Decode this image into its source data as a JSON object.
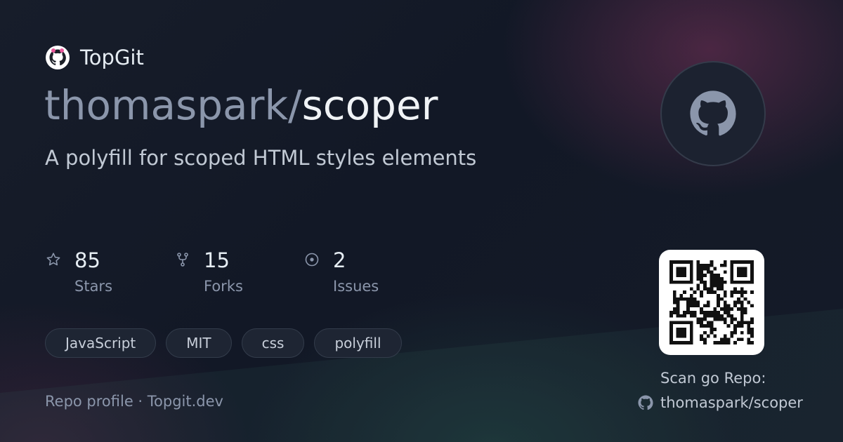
{
  "brand": {
    "name": "TopGit"
  },
  "repo": {
    "owner": "thomaspark/",
    "name": "scoper",
    "description": "A polyfill for scoped HTML styles elements"
  },
  "stats": [
    {
      "icon": "star-icon",
      "value": "85",
      "label": "Stars"
    },
    {
      "icon": "fork-icon",
      "value": "15",
      "label": "Forks"
    },
    {
      "icon": "issue-icon",
      "value": "2",
      "label": "Issues"
    }
  ],
  "tags": [
    "JavaScript",
    "MIT",
    "css",
    "polyfill"
  ],
  "footer": {
    "text": "Repo profile · Topgit.dev"
  },
  "qr": {
    "caption": "Scan go Repo:",
    "link": "thomaspark/scoper"
  },
  "colors": {
    "accent_pink": "#e8579a",
    "muted": "#8b96ab",
    "text": "#e6edf3",
    "background": "#141a27"
  }
}
